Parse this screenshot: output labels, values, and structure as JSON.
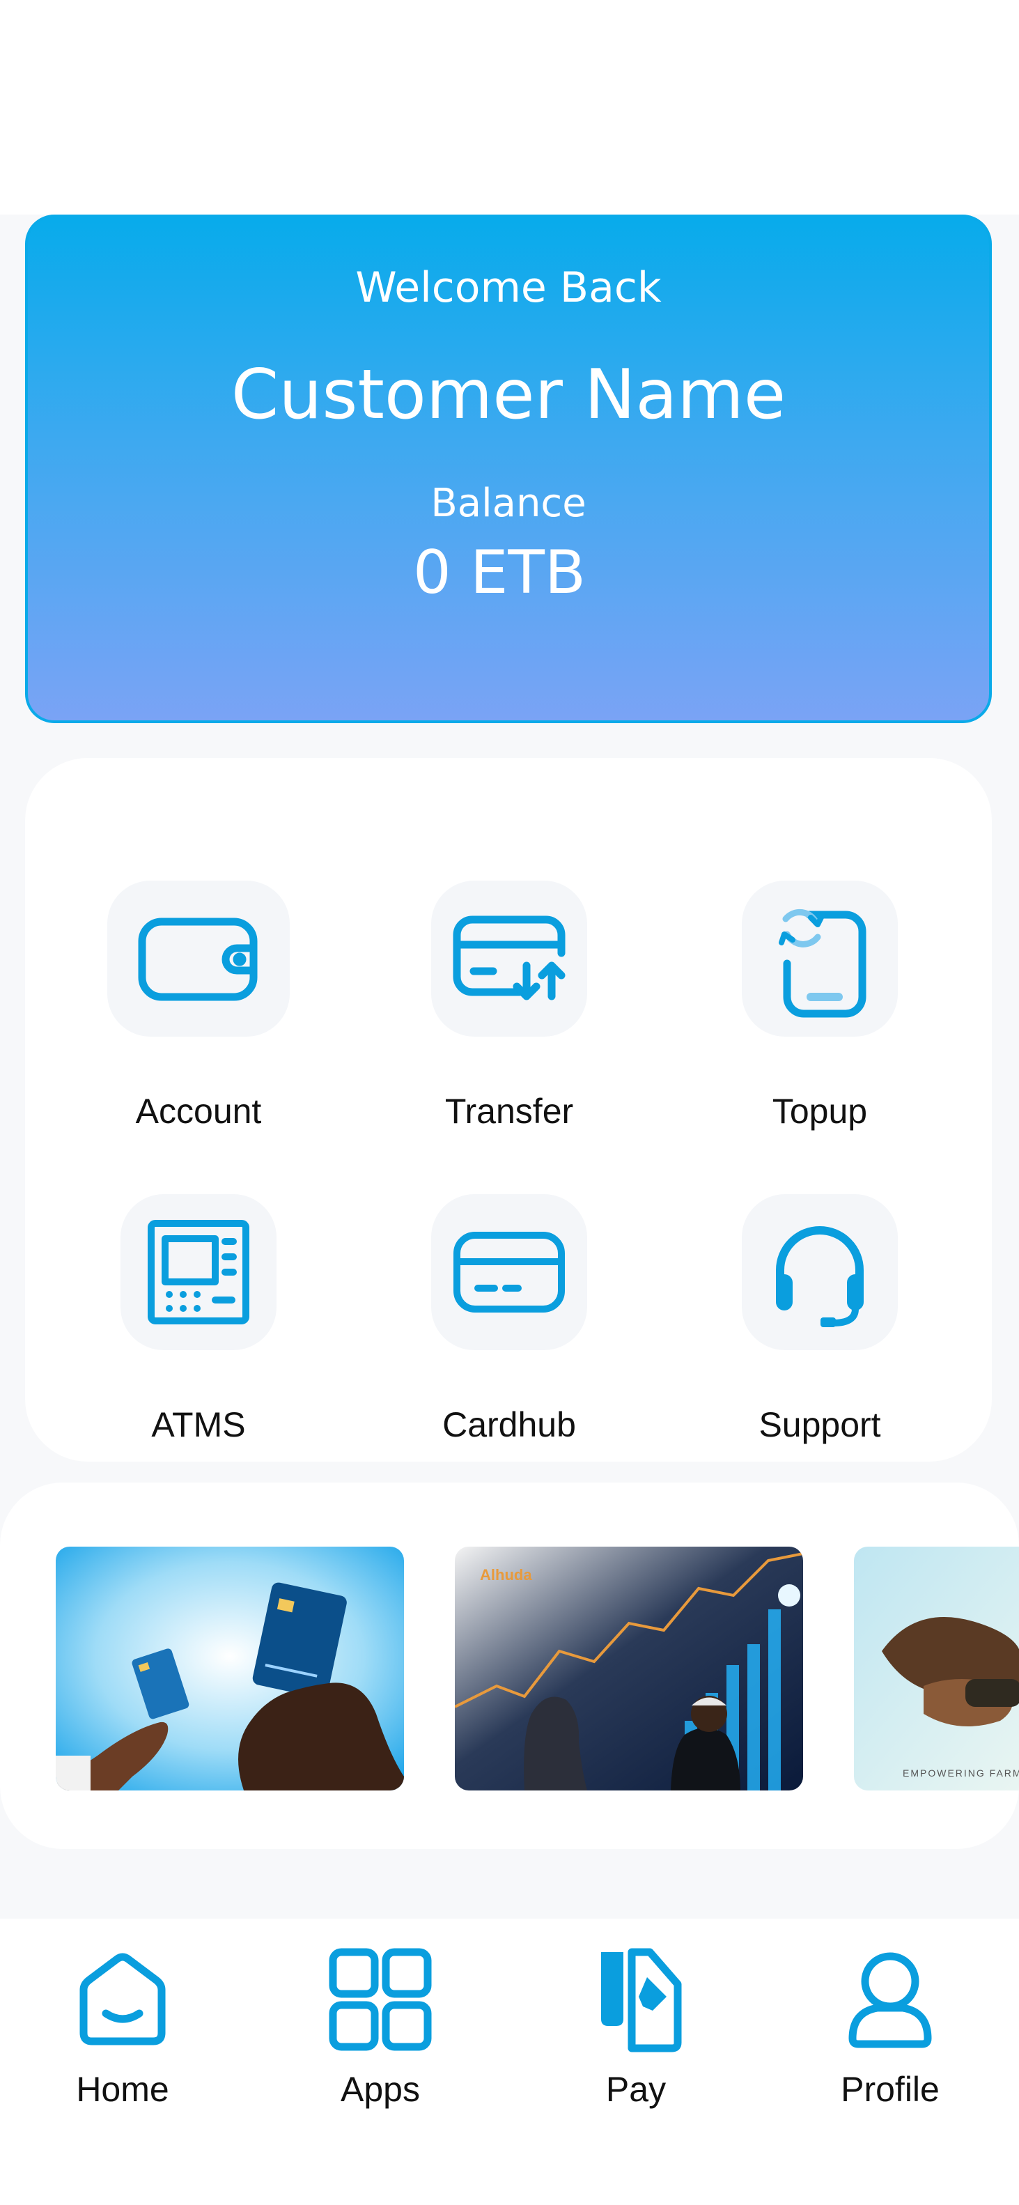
{
  "welcome": {
    "greeting": "Welcome Back",
    "customer_name": "Customer Name",
    "balance_label": "Balance",
    "balance_value": "0 ETB"
  },
  "services": [
    {
      "label": "Account",
      "icon": "wallet-icon"
    },
    {
      "label": "Transfer",
      "icon": "card-transfer-icon"
    },
    {
      "label": "Topup",
      "icon": "phone-topup-icon"
    },
    {
      "label": "ATMS",
      "icon": "atm-icon"
    },
    {
      "label": "Cardhub",
      "icon": "card-icon"
    },
    {
      "label": "Support",
      "icon": "headset-icon"
    }
  ],
  "banners": {
    "banner2_logo": "Alhuda",
    "banner3_caption": "EMPOWERING FARMERS"
  },
  "nav": [
    {
      "label": "Home",
      "icon": "home-icon"
    },
    {
      "label": "Apps",
      "icon": "apps-grid-icon"
    },
    {
      "label": "Pay",
      "icon": "pay-document-icon"
    },
    {
      "label": "Profile",
      "icon": "profile-icon"
    }
  ],
  "colors": {
    "accent": "#0aa0e0",
    "card_gradient_top": "#08abeb",
    "card_gradient_bottom": "#7aa3f5"
  }
}
